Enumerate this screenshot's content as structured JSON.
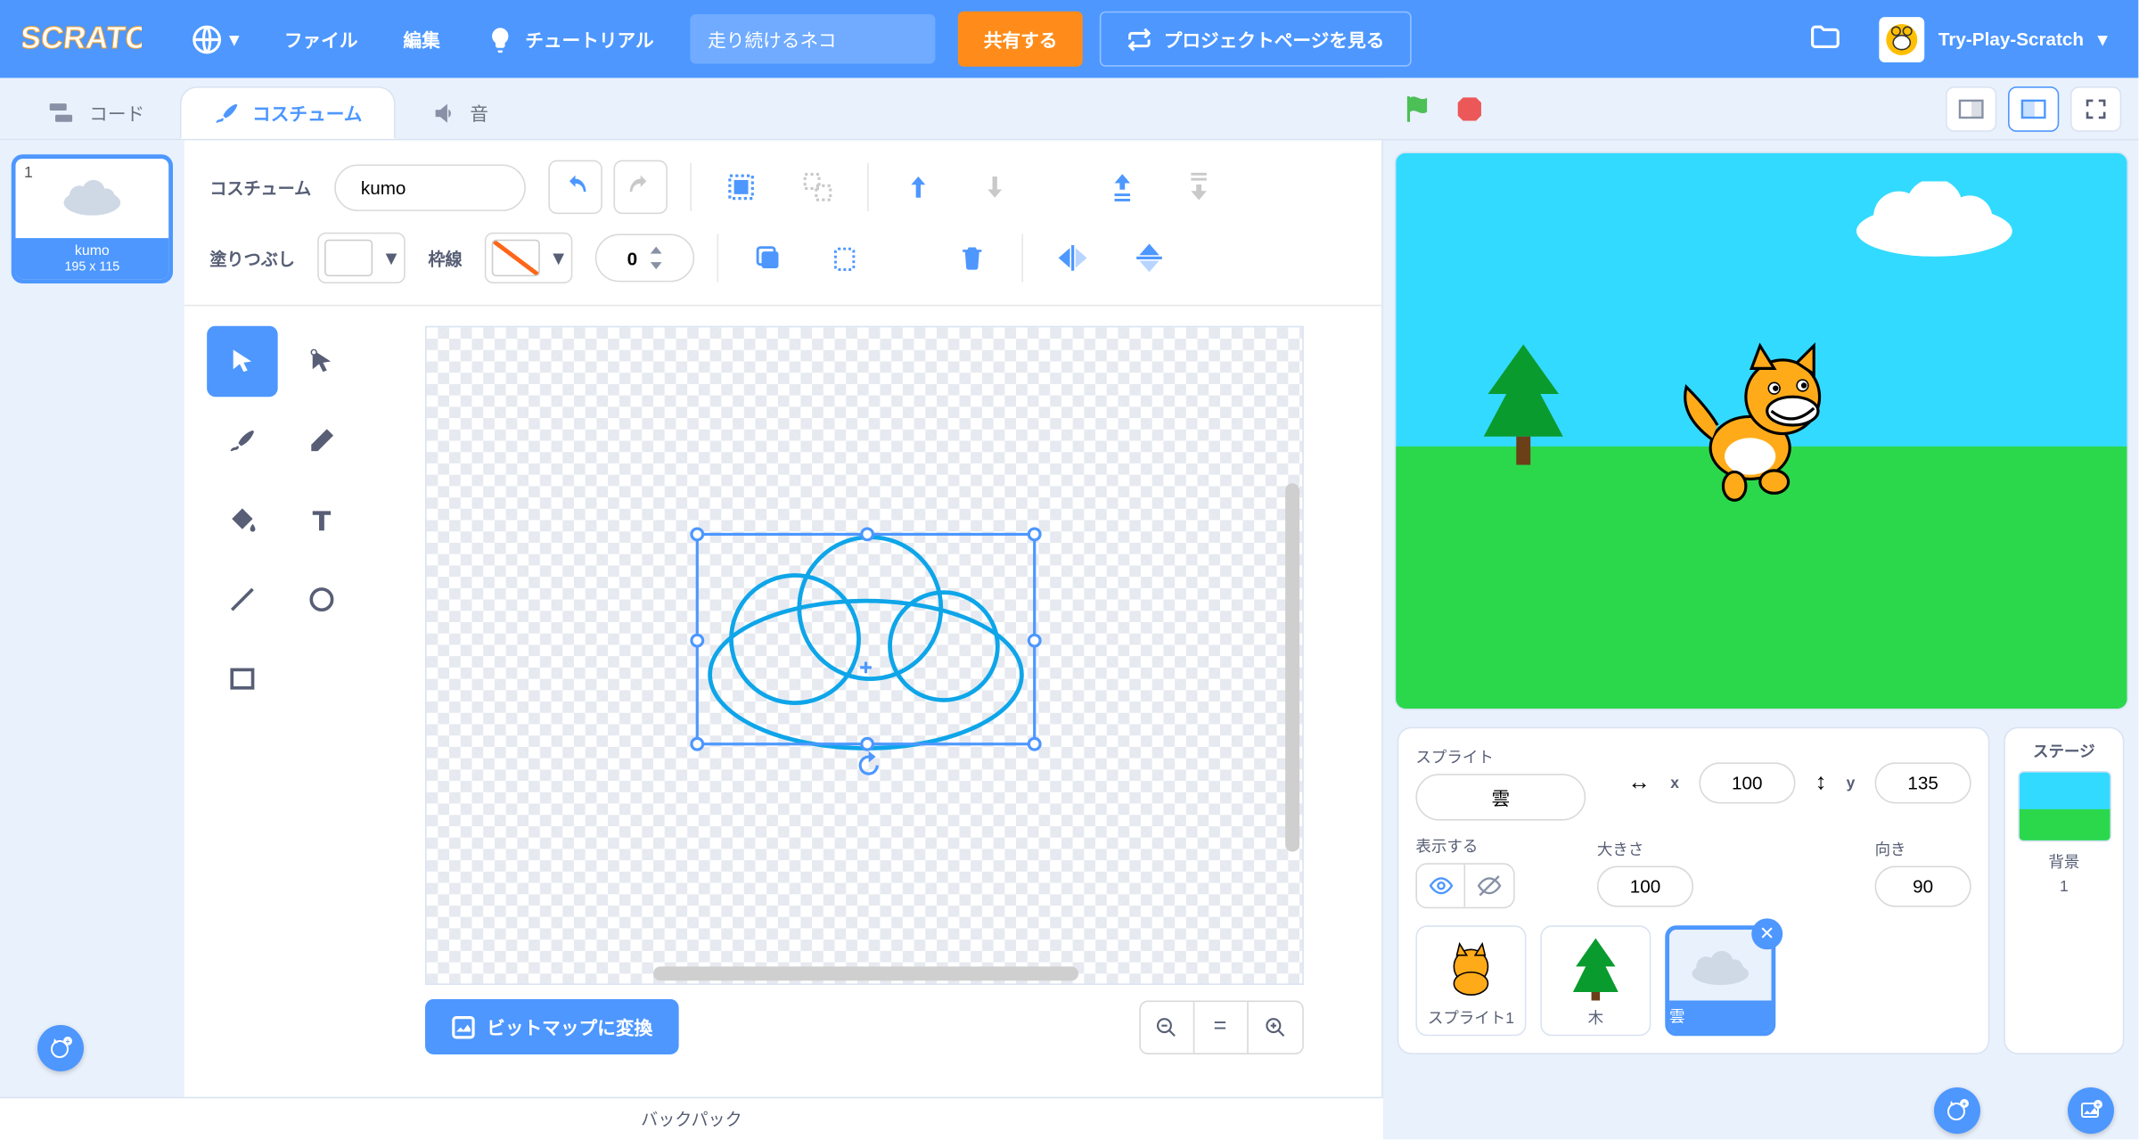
{
  "menubar": {
    "file": "ファイル",
    "edit": "編集",
    "tutorials": "チュートリアル",
    "project_title": "走り続けるネコ",
    "share": "共有する",
    "see_page": "プロジェクトページを見る",
    "username": "Try-Play-Scratch"
  },
  "tabs": {
    "code": "コード",
    "costumes": "コスチューム",
    "sounds": "音"
  },
  "costume_list": {
    "selected": {
      "index": "1",
      "name": "kumo",
      "size": "195 x 115"
    }
  },
  "editor": {
    "costume_label": "コスチューム",
    "costume_name": "kumo",
    "fill_label": "塗りつぶし",
    "outline_label": "枠線",
    "outline_width": "0",
    "convert_bitmap": "ビットマップに変換"
  },
  "sprite_info": {
    "sprite_label": "スプライト",
    "sprite_name": "雲",
    "x_label": "x",
    "x_value": "100",
    "y_label": "y",
    "y_value": "135",
    "show_label": "表示する",
    "size_label": "大きさ",
    "size_value": "100",
    "direction_label": "向き",
    "direction_value": "90"
  },
  "sprites": [
    {
      "name": "スプライト1"
    },
    {
      "name": "木"
    },
    {
      "name": "雲"
    }
  ],
  "stage": {
    "label": "ステージ",
    "backdrops_label": "背景",
    "backdrops_count": "1"
  },
  "backpack": "バックパック"
}
